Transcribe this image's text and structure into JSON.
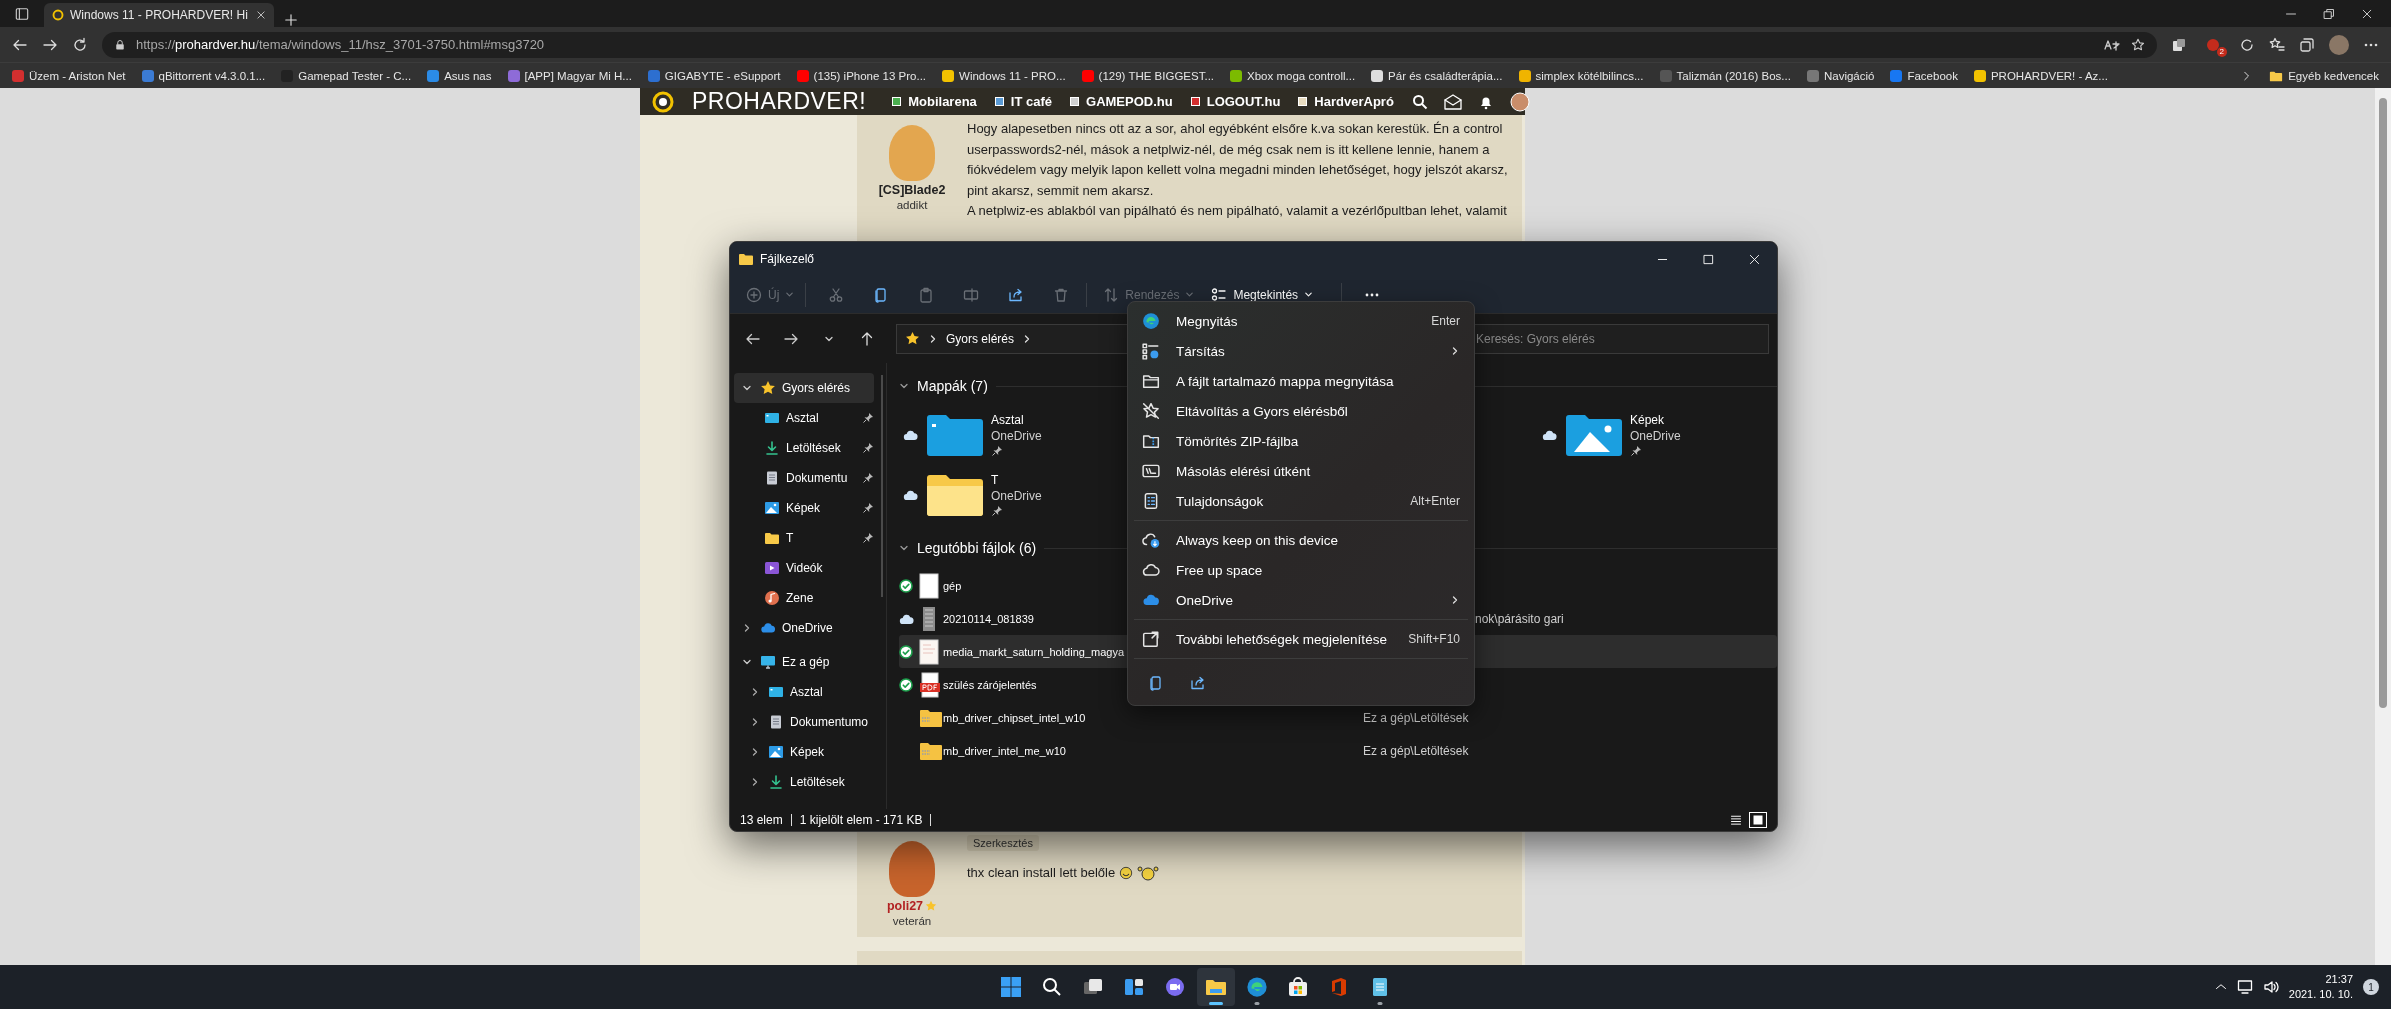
{
  "browser": {
    "tab": {
      "title": "Windows 11 - PROHARDVER! Hi"
    },
    "address": {
      "scheme": "https://",
      "host": "prohardver.hu",
      "path": "/tema/windows_11/hsz_3701-3750.html#msg3720"
    },
    "extension_badge": "2",
    "bookmarks": [
      {
        "label": "Üzem - Ariston Net",
        "color": "#d32f2f"
      },
      {
        "label": "qBittorrent v4.3.0.1...",
        "color": "#3b7bd4"
      },
      {
        "label": "Gamepad Tester - C...",
        "color": "#222222"
      },
      {
        "label": "Asus nas",
        "color": "#2b8be6"
      },
      {
        "label": "[APP] Magyar Mi H...",
        "color": "#8e6bd8"
      },
      {
        "label": "GIGABYTE - eSupport",
        "color": "#2d6fd0"
      },
      {
        "label": "(135) iPhone 13 Pro...",
        "color": "#ff0000"
      },
      {
        "label": "Windows 11 - PRO...",
        "color": "#f2c200"
      },
      {
        "label": "(129) THE BIGGEST...",
        "color": "#ff0000"
      },
      {
        "label": "Xbox moga controll...",
        "color": "#7cbb00"
      },
      {
        "label": "Pár és családterápia...",
        "color": "#dddddd"
      },
      {
        "label": "simplex kötélbilincs...",
        "color": "#f0b400"
      },
      {
        "label": "Talizmán (2016) Bos...",
        "color": "#555555"
      },
      {
        "label": "Navigáció",
        "color": "#777777"
      },
      {
        "label": "Facebook",
        "color": "#1877f2"
      },
      {
        "label": "PROHARDVER! - Az...",
        "color": "#f2c200"
      }
    ],
    "more_bookmarks": "Egyéb kedvencek"
  },
  "site": {
    "logo": "PROHARDVER!",
    "nav": [
      {
        "label": "Mobilarena",
        "color": "#4caf50"
      },
      {
        "label": "IT café",
        "color": "#5b9bd5"
      },
      {
        "label": "GAMEPOD.hu",
        "color": "#d0d0d0"
      },
      {
        "label": "LOGOUT.hu",
        "color": "#d32f2f"
      },
      {
        "label": "HardverApró",
        "color": "#e8dcc0"
      }
    ]
  },
  "posts": [
    {
      "author": "[CS]Blade2",
      "rank": "addikt",
      "paragraphs": [
        "Hogy alapesetben nincs ott az a sor, ahol egyébként elsőre k.va sokan kerestük. Én a control userpasswords2-nél, mások a netplwiz-nél, de még csak nem is itt kellene lennie, hanem a fiókvédelem vagy melyik lapon kellett volna megadni minden lehetőséget, hogy jelszót akarsz, pint akarsz, semmit nem akarsz.",
        "A netplwiz-es ablakból van pipálható és nem pipálható, valamit a vezérlőpultban lehet, valamit"
      ]
    },
    {
      "author": "poli27",
      "rank": "veterán",
      "edit_tag": "Szerkesztés",
      "paragraphs": [
        "thx clean install lett belőle"
      ]
    }
  ],
  "explorer": {
    "title": "Fájlkezelő",
    "toolbar": [
      {
        "kind": "new",
        "label": "Új",
        "disabled": true
      },
      {
        "kind": "cut",
        "disabled": true
      },
      {
        "kind": "copy",
        "disabled": false
      },
      {
        "kind": "paste",
        "disabled": true
      },
      {
        "kind": "rename",
        "disabled": true
      },
      {
        "kind": "share",
        "disabled": false
      },
      {
        "kind": "delete",
        "disabled": true
      },
      {
        "kind": "sort",
        "label": "Rendezés",
        "disabled": true
      },
      {
        "kind": "view",
        "label": "Megtekintés",
        "disabled": false
      },
      {
        "kind": "more",
        "disabled": false
      }
    ],
    "breadcrumb": "Gyors elérés",
    "search": {
      "placeholder": "Keresés: Gyors elérés"
    },
    "sidebar": [
      {
        "label": "Gyors elérés",
        "kind": "star",
        "expanded": true,
        "selected": true,
        "children": [
          {
            "label": "Asztal",
            "kind": "desktop",
            "pinned": true,
            "selected": false
          },
          {
            "label": "Letöltések",
            "kind": "download",
            "pinned": true,
            "selected": false
          },
          {
            "label": "Dokumentu",
            "kind": "document",
            "pinned": true,
            "selected": false
          },
          {
            "label": "Képek",
            "kind": "pictures",
            "pinned": true,
            "selected": false
          },
          {
            "label": "T",
            "kind": "folder",
            "pinned": true,
            "selected": false
          },
          {
            "label": "Videók",
            "kind": "videos",
            "pinned": false,
            "selected": false
          },
          {
            "label": "Zene",
            "kind": "music",
            "pinned": false,
            "selected": false
          }
        ]
      },
      {
        "label": "OneDrive",
        "kind": "cloud",
        "expanded": false,
        "selected": false
      },
      {
        "label": "Ez a gép",
        "kind": "pc",
        "expanded": true,
        "selected": false,
        "children": [
          {
            "label": "Asztal",
            "kind": "desktop",
            "expanded": false,
            "selected": false
          },
          {
            "label": "Dokumentumo",
            "kind": "document",
            "expanded": false,
            "selected": false
          },
          {
            "label": "Képek",
            "kind": "pictures",
            "expanded": false,
            "selected": false
          },
          {
            "label": "Letöltések",
            "kind": "download",
            "expanded": false,
            "selected": false
          }
        ]
      }
    ],
    "folders": {
      "title": "Mappák (7)",
      "expanded": true,
      "items": [
        {
          "name": "Asztal",
          "location": "OneDrive",
          "kind": "desktop",
          "pinned": true,
          "online_only": true
        },
        {
          "name": "Képek",
          "location": "OneDrive",
          "kind": "pictures",
          "pinned": true,
          "online_only": true
        },
        {
          "name": "T",
          "location": "OneDrive",
          "kind": "folder",
          "pinned": true,
          "online_only": true
        }
      ]
    },
    "recent": {
      "title": "Legutóbbi fájlok (6)",
      "expanded": true,
      "items": [
        {
          "name": "gép",
          "kind": "document",
          "synced": true,
          "online_only": false,
          "selected": false
        },
        {
          "name": "20210114_081839",
          "kind": "image",
          "synced": false,
          "online_only": true,
          "selected": false,
          "location": "nok\\párásito gari",
          "location_covered": true
        },
        {
          "name": "media_markt_saturn_holding_magya",
          "kind": "scan",
          "synced": true,
          "online_only": false,
          "selected": true
        },
        {
          "name": "szülés zárójelentés",
          "kind": "pdf",
          "synced": true,
          "online_only": false,
          "selected": false
        },
        {
          "name": "mb_driver_chipset_intel_w10",
          "kind": "zip",
          "synced": false,
          "online_only": false,
          "selected": false,
          "location": "Ez a gép\\Letöltések",
          "location_covered": false
        },
        {
          "name": "mb_driver_intel_me_w10",
          "kind": "zip",
          "synced": false,
          "online_only": false,
          "selected": false,
          "location": "Ez a gép\\Letöltések",
          "location_covered": false
        }
      ]
    },
    "status_bar": {
      "count": "13 elem",
      "selection": "1 kijelölt elem - 171 KB",
      "views": [
        {
          "kind": "details",
          "selected": false
        },
        {
          "kind": "tiles",
          "selected": true
        }
      ]
    }
  },
  "context_menu": {
    "groups": [
      [
        {
          "kind": "edge",
          "label": "Megnyitás",
          "shortcut": "Enter",
          "submenu": false
        },
        {
          "kind": "open-with",
          "label": "Társítás",
          "submenu": true
        },
        {
          "kind": "folder-open",
          "label": "A fájlt tartalmazó mappa megnyitása",
          "submenu": false
        },
        {
          "kind": "unstar",
          "label": "Eltávolítás a Gyors elérésből",
          "submenu": false
        },
        {
          "kind": "zip",
          "label": "Tömörítés ZIP-fájlba",
          "submenu": false
        },
        {
          "kind": "path",
          "label": "Másolás elérési útként",
          "submenu": false
        },
        {
          "kind": "properties",
          "label": "Tulajdonságok",
          "shortcut": "Alt+Enter",
          "submenu": false
        }
      ],
      [
        {
          "kind": "cloud-keep",
          "label": "Always keep on this device",
          "submenu": false
        },
        {
          "kind": "cloud",
          "label": "Free up space",
          "submenu": false
        },
        {
          "kind": "onedrive",
          "label": "OneDrive",
          "submenu": true
        }
      ],
      [
        {
          "kind": "more",
          "label": "További lehetőségek megjelenítése",
          "shortcut": "Shift+F10",
          "submenu": false
        }
      ]
    ],
    "quick_actions": [
      {
        "kind": "copy"
      },
      {
        "kind": "share"
      }
    ]
  },
  "taskbar": {
    "apps": [
      {
        "kind": "start",
        "running": false,
        "active": false
      },
      {
        "kind": "search",
        "running": false,
        "active": false
      },
      {
        "kind": "taskview",
        "running": false,
        "active": false
      },
      {
        "kind": "widgets",
        "running": false,
        "active": false
      },
      {
        "kind": "chat",
        "running": false,
        "active": false
      },
      {
        "kind": "explorer",
        "running": true,
        "active": true
      },
      {
        "kind": "edge",
        "running": true,
        "active": false
      },
      {
        "kind": "store",
        "running": false,
        "active": false
      },
      {
        "kind": "office",
        "running": false,
        "active": false
      },
      {
        "kind": "notepad",
        "running": true,
        "active": false
      }
    ],
    "time": "21:37",
    "date": "2021. 10. 10.",
    "notifications": "1"
  }
}
